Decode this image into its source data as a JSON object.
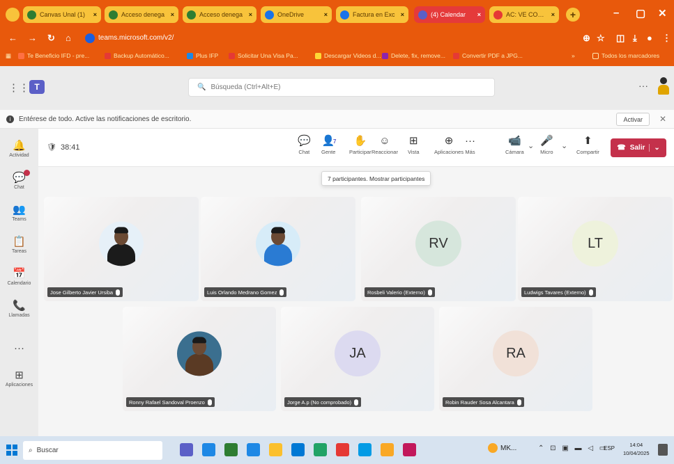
{
  "browser": {
    "tabs": [
      {
        "label": "Canvas Unal (1)",
        "color": "#2e7d32"
      },
      {
        "label": "Acceso denega",
        "color": "#2e7d32"
      },
      {
        "label": "Acceso denega",
        "color": "#2e7d32"
      },
      {
        "label": "OneDrive",
        "color": "#1a73e8"
      },
      {
        "label": "Factura en Exc",
        "color": "#1a73e8"
      },
      {
        "label": "(4) Calendar",
        "color": "#5b5fc7",
        "active": true
      },
      {
        "label": "AC: VE CONVOCT",
        "color": "#e53935"
      }
    ],
    "url": "teams.microsoft.com/v2/",
    "bookmarks": [
      {
        "label": "Te Beneficio IFD - pre...",
        "color": "#ff7043"
      },
      {
        "label": "Backup Automático...",
        "color": "#e53935"
      },
      {
        "label": "Plus IFP",
        "color": "#1e88e5"
      },
      {
        "label": "Solicitar Una Visa Pa...",
        "color": "#e53935"
      },
      {
        "label": "Descargar Videos d...",
        "color": "#fdd835"
      },
      {
        "label": "Delete, fix, remove...",
        "color": "#8e24aa"
      },
      {
        "label": "Convertir PDF a JPG...",
        "color": "#e53935"
      }
    ],
    "bookmarks_right": "Todos los marcadores"
  },
  "teams": {
    "search_placeholder": "Búsqueda (Ctrl+Alt+E)"
  },
  "notification": {
    "text": "Entérese de todo. Active las notificaciones de escritorio.",
    "activate_label": "Activar"
  },
  "rail": [
    {
      "icon": "bell-icon",
      "glyph": "🔔",
      "label": "Actividad"
    },
    {
      "icon": "chat-icon",
      "glyph": "💬",
      "label": "Chat",
      "badge": true
    },
    {
      "icon": "teams-icon",
      "glyph": "👥",
      "label": "Teams"
    },
    {
      "icon": "tasks-icon",
      "glyph": "📋",
      "label": "Tareas"
    },
    {
      "icon": "calendar-icon",
      "glyph": "📅",
      "label": "Calendario"
    },
    {
      "icon": "calls-icon",
      "glyph": "📞",
      "label": "Llamadas"
    },
    {
      "icon": "more-icon",
      "glyph": "···",
      "label": ""
    },
    {
      "icon": "apps-icon",
      "glyph": "⊞",
      "label": "Aplicaciones"
    }
  ],
  "meeting": {
    "timer": "38:41",
    "tools": [
      {
        "name": "chat",
        "glyph": "💬",
        "label": "Chat"
      },
      {
        "name": "people",
        "glyph": "👤",
        "label": "Gente",
        "highlight": true,
        "count": "7"
      },
      {
        "name": "raise-hand",
        "glyph": "✋",
        "label": "Participar"
      },
      {
        "name": "react",
        "glyph": "☺",
        "label": "Reaccionar"
      },
      {
        "name": "view",
        "glyph": "⊞",
        "label": "Vista"
      },
      {
        "name": "apps",
        "glyph": "⊕",
        "label": "Aplicaciones"
      },
      {
        "name": "more",
        "glyph": "···",
        "label": "Más"
      },
      {
        "name": "camera",
        "glyph": "📹",
        "label": "Cámara"
      },
      {
        "name": "mic",
        "glyph": "🎤",
        "label": "Micro"
      },
      {
        "name": "share",
        "glyph": "⬆",
        "label": "Compartir"
      }
    ],
    "leave_label": "Salir",
    "tooltip": "7 participantes. Mostrar participantes"
  },
  "participants": [
    {
      "name": "Jose Gilberto Javier Ursiba",
      "type": "photo",
      "shirt": "#1b1b1b",
      "bg": "#e6f0f8"
    },
    {
      "name": "Luis Orlando Medrano Gomez",
      "type": "photo",
      "shirt": "#2a7bd3",
      "bg": "#d7ecf8"
    },
    {
      "name": "Rosbeli Valerio (Externo)",
      "type": "initials",
      "initials": "RV",
      "circle": "#d6e6dc"
    },
    {
      "name": "Ludwigs Tavares (Externo)",
      "type": "initials",
      "initials": "LT",
      "circle": "#eef2dc"
    },
    {
      "name": "Ronny Rafael Sandoval Proenzo",
      "type": "photo",
      "shirt": "#5a3a24",
      "bg": "#3b6f8f"
    },
    {
      "name": "Jorge A.p (No comprobado)",
      "type": "initials",
      "initials": "JA",
      "circle": "#dcdaf0"
    },
    {
      "name": "Robin Rauder Sosa Alcantara",
      "type": "initials",
      "initials": "RA",
      "circle": "#f1e1d8"
    }
  ],
  "taskbar": {
    "search_label": "Buscar",
    "apps": [
      "#5b5fc7",
      "#1e88e5",
      "#2e7d32",
      "#1e88e5",
      "#fbc02d",
      "#0078d4",
      "#21a366",
      "#e53935",
      "#039be5",
      "#f9a825",
      "#c2185b"
    ],
    "weather": "MK...",
    "lang": "ESP",
    "time": "14:04",
    "date": "10/04/2025"
  }
}
